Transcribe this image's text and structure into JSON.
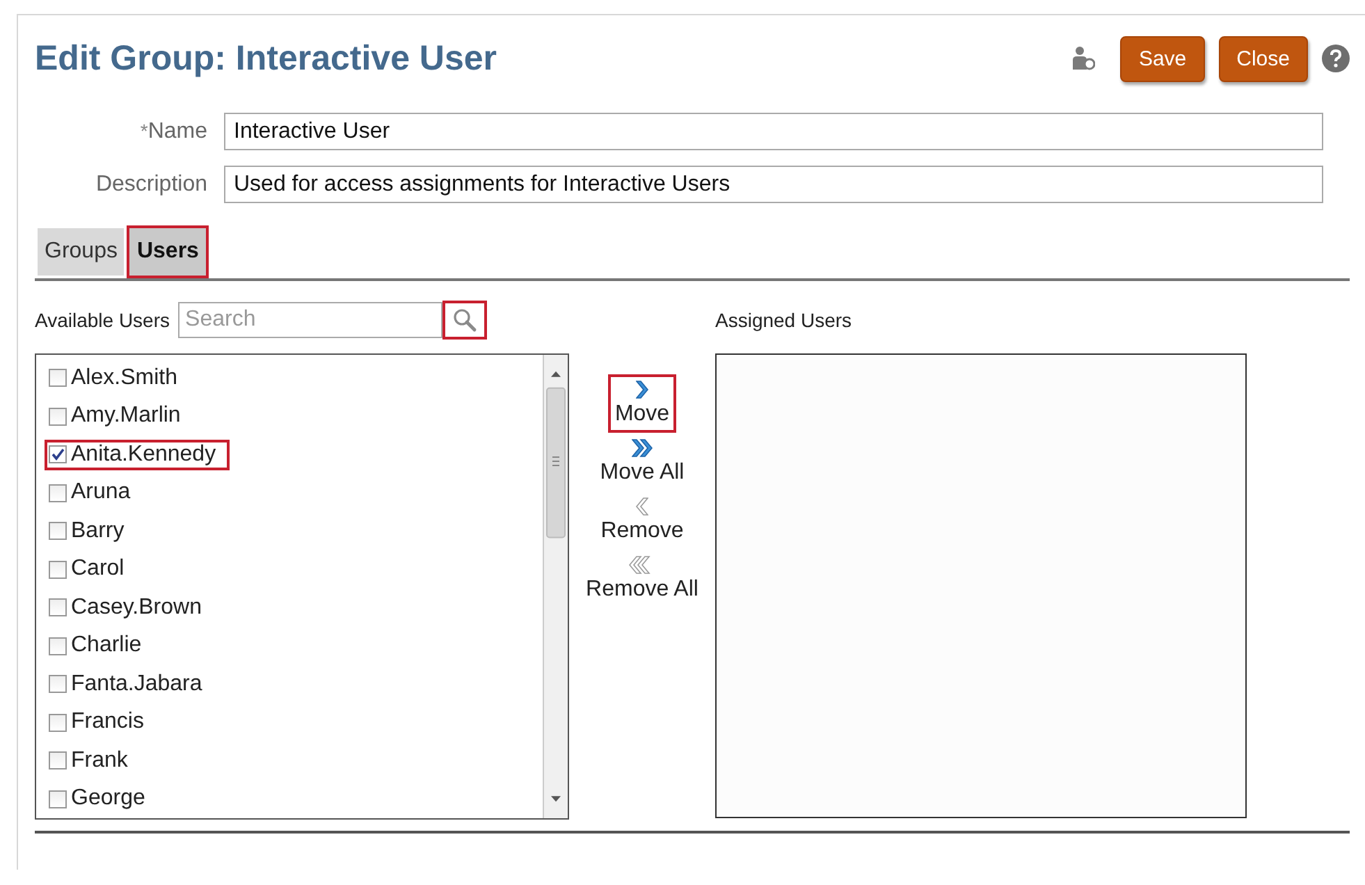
{
  "page": {
    "title": "Edit Group: Interactive User"
  },
  "toolbar": {
    "buttons": [
      {
        "label": "Save"
      },
      {
        "label": "Close"
      }
    ]
  },
  "form": {
    "fields": [
      {
        "label": "Name",
        "required": true,
        "value": "Interactive User"
      },
      {
        "label": "Description",
        "required": false,
        "value": "Used for access assignments for Interactive Users"
      }
    ],
    "required_mark": "*"
  },
  "tabs": [
    {
      "label": "Groups",
      "selected": false,
      "highlighted": false
    },
    {
      "label": "Users",
      "selected": true,
      "highlighted": true
    }
  ],
  "available": {
    "label": "Available Users",
    "search": {
      "placeholder": "Search",
      "highlighted": true
    },
    "users": [
      {
        "name": "Alex.Smith",
        "checked": false,
        "highlighted": false
      },
      {
        "name": "Amy.Marlin",
        "checked": false,
        "highlighted": false
      },
      {
        "name": "Anita.Kennedy",
        "checked": true,
        "highlighted": true
      },
      {
        "name": "Aruna",
        "checked": false,
        "highlighted": false
      },
      {
        "name": "Barry",
        "checked": false,
        "highlighted": false
      },
      {
        "name": "Carol",
        "checked": false,
        "highlighted": false
      },
      {
        "name": "Casey.Brown",
        "checked": false,
        "highlighted": false
      },
      {
        "name": "Charlie",
        "checked": false,
        "highlighted": false
      },
      {
        "name": "Fanta.Jabara",
        "checked": false,
        "highlighted": false
      },
      {
        "name": "Francis",
        "checked": false,
        "highlighted": false
      },
      {
        "name": "Frank",
        "checked": false,
        "highlighted": false
      },
      {
        "name": "George",
        "checked": false,
        "highlighted": false
      }
    ]
  },
  "actions": [
    {
      "label": "Move",
      "kind": "single-right",
      "disabled": false,
      "highlighted": true
    },
    {
      "label": "Move All",
      "kind": "double-right",
      "disabled": false,
      "highlighted": false
    },
    {
      "label": "Remove",
      "kind": "single-left",
      "disabled": true,
      "highlighted": false
    },
    {
      "label": "Remove All",
      "kind": "double-left",
      "disabled": true,
      "highlighted": false
    }
  ],
  "assigned": {
    "label": "Assigned Users"
  }
}
